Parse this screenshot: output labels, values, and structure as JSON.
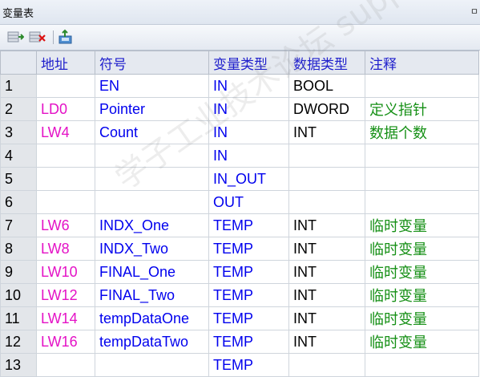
{
  "window": {
    "title": "变量表",
    "pin_glyph": "ㅁ"
  },
  "toolbar": {
    "icons": [
      "insert-row-icon",
      "delete-row-icon",
      "export-icon"
    ]
  },
  "table": {
    "headers": [
      "",
      "地址",
      "符号",
      "变量类型",
      "数据类型",
      "注释"
    ],
    "rows": [
      {
        "num": "1",
        "addr": "",
        "sym": "EN",
        "vtype": "IN",
        "dtype": "BOOL",
        "cmt": ""
      },
      {
        "num": "2",
        "addr": "LD0",
        "sym": "Pointer",
        "vtype": "IN",
        "dtype": "DWORD",
        "cmt": "定义指针"
      },
      {
        "num": "3",
        "addr": "LW4",
        "sym": "Count",
        "vtype": "IN",
        "dtype": "INT",
        "cmt": "数据个数"
      },
      {
        "num": "4",
        "addr": "",
        "sym": "",
        "vtype": "IN",
        "dtype": "",
        "cmt": ""
      },
      {
        "num": "5",
        "addr": "",
        "sym": "",
        "vtype": "IN_OUT",
        "dtype": "",
        "cmt": ""
      },
      {
        "num": "6",
        "addr": "",
        "sym": "",
        "vtype": "OUT",
        "dtype": "",
        "cmt": ""
      },
      {
        "num": "7",
        "addr": "LW6",
        "sym": "INDX_One",
        "vtype": "TEMP",
        "dtype": "INT",
        "cmt": "临时变量"
      },
      {
        "num": "8",
        "addr": "LW8",
        "sym": "INDX_Two",
        "vtype": "TEMP",
        "dtype": "INT",
        "cmt": "临时变量"
      },
      {
        "num": "9",
        "addr": "LW10",
        "sym": "FINAL_One",
        "vtype": "TEMP",
        "dtype": "INT",
        "cmt": "临时变量"
      },
      {
        "num": "10",
        "addr": "LW12",
        "sym": "FINAL_Two",
        "vtype": "TEMP",
        "dtype": "INT",
        "cmt": "临时变量"
      },
      {
        "num": "11",
        "addr": "LW14",
        "sym": "tempDataOne",
        "vtype": "TEMP",
        "dtype": "INT",
        "cmt": "临时变量"
      },
      {
        "num": "12",
        "addr": "LW16",
        "sym": "tempDataTwo",
        "vtype": "TEMP",
        "dtype": "INT",
        "cmt": "临时变量"
      },
      {
        "num": "13",
        "addr": "",
        "sym": "",
        "vtype": "TEMP",
        "dtype": "",
        "cmt": ""
      }
    ]
  },
  "watermark": "学子工业技术论坛 support.automation.siemens.com.cn",
  "colors": {
    "address": "#e412c6",
    "symbol": "#0000ee",
    "comment": "#169016",
    "header_text": "#2020cc"
  }
}
